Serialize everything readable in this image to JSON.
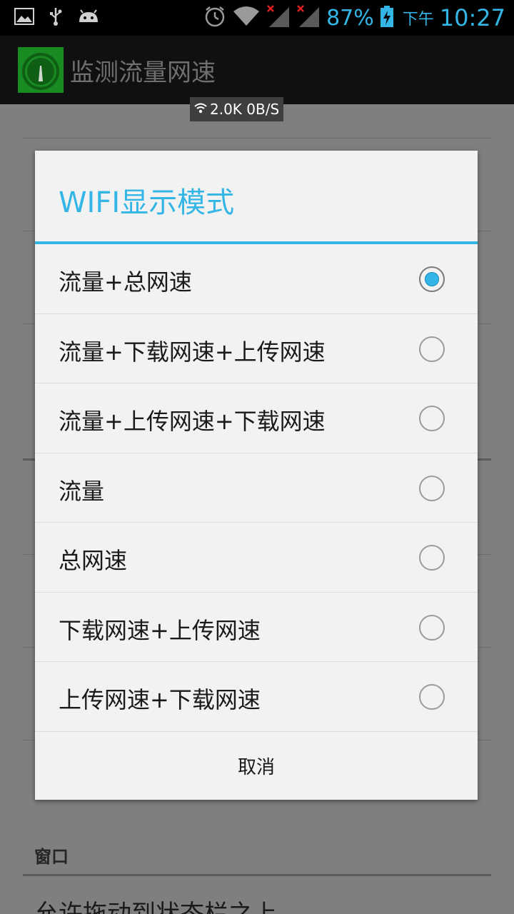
{
  "status_bar": {
    "battery_percent": "87%",
    "am_pm": "下午",
    "time": "10:27",
    "accent_color": "#33b5e5"
  },
  "action_bar": {
    "title": "监测流量网速"
  },
  "speed_overlay": {
    "text": "2.0K 0B/S"
  },
  "dialog": {
    "title": "WIFI显示模式",
    "options": [
      {
        "label": "流量+总网速",
        "selected": true
      },
      {
        "label": "流量+下载网速+上传网速",
        "selected": false
      },
      {
        "label": "流量+上传网速+下载网速",
        "selected": false
      },
      {
        "label": "流量",
        "selected": false
      },
      {
        "label": "总网速",
        "selected": false
      },
      {
        "label": "下载网速+上传网速",
        "selected": false
      },
      {
        "label": "上传网速+下载网速",
        "selected": false
      }
    ],
    "cancel_label": "取消"
  },
  "background_page": {
    "section_header": "窗口",
    "visible_item": "允许拖动到状态栏之上"
  }
}
